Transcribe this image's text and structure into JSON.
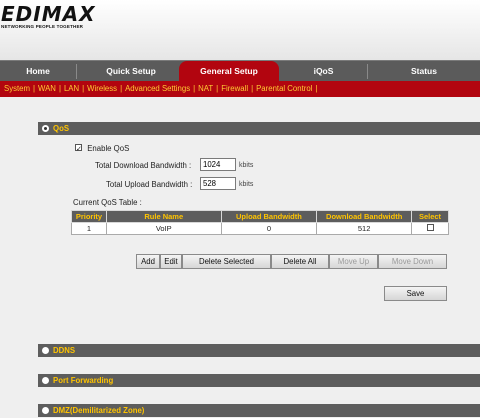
{
  "brand": {
    "logo": "EDIMAX",
    "tagline": "NETWORKING PEOPLE TOGETHER"
  },
  "tabs": [
    {
      "label": "Home"
    },
    {
      "label": "Quick Setup"
    },
    {
      "label": "General Setup",
      "active": true
    },
    {
      "label": "iQoS"
    },
    {
      "label": "Status"
    }
  ],
  "subnav": {
    "items": [
      "System",
      "WAN",
      "LAN",
      "Wireless",
      "Advanced Settings",
      "NAT",
      "Firewall",
      "Parental Control"
    ],
    "separator": "|"
  },
  "qos": {
    "section_title": "QoS",
    "enable_label": "Enable QoS",
    "enabled": true,
    "download_label": "Total Download Bandwidth :",
    "download_value": "1024",
    "download_unit": "kbits",
    "upload_label": "Total Upload Bandwidth :",
    "upload_value": "528",
    "upload_unit": "kbits",
    "table_title": "Current QoS Table :",
    "columns": [
      "Priority",
      "Rule Name",
      "Upload Bandwidth",
      "Download Bandwidth",
      "Select"
    ],
    "rows": [
      {
        "priority": "1",
        "rule_name": "VoIP",
        "upload": "0",
        "download": "512",
        "selected": false
      }
    ],
    "buttons": {
      "add": "Add",
      "edit": "Edit",
      "delete_selected": "Delete Selected",
      "delete_all": "Delete All",
      "move_up": "Move Up",
      "move_down": "Move Down",
      "save": "Save"
    }
  },
  "sections": {
    "ddns": "DDNS",
    "port_forwarding": "Port Forwarding",
    "dmz": "DMZ(Demilitarized Zone)"
  },
  "colors": {
    "accent_red": "#b2050f",
    "section_gray": "#5d5d5d",
    "section_text": "#ffc400",
    "subnav_text": "#ffcc33"
  }
}
